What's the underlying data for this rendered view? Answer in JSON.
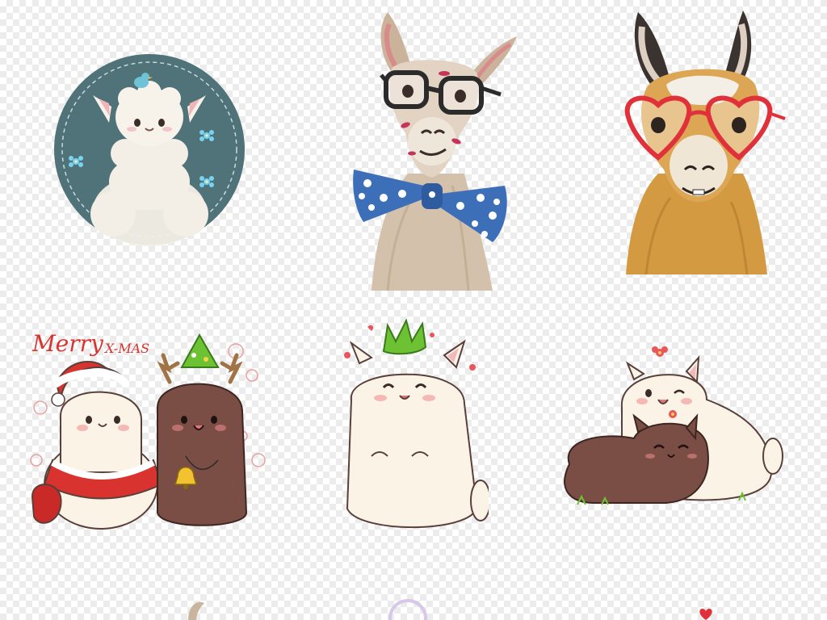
{
  "sheet": {
    "background": "transparent-checkerboard",
    "illustrations": [
      {
        "id": "round-badge-alpaca",
        "palette": {
          "disc": "#4f7378",
          "fur": "#f4efe6"
        }
      },
      {
        "id": "watercolor-llama-bowtie",
        "palette": {
          "fur": "#c9b49e",
          "bowtie": "#3d6fb8",
          "glasses": "#2b2b2b"
        }
      },
      {
        "id": "watercolor-llama-heart-glasses",
        "palette": {
          "fur": "#d39a42",
          "glasses": "#e0303a"
        }
      },
      {
        "id": "christmas-alpaca-pair",
        "text": {
          "merry": "Merry",
          "xmas": "X-MAS"
        },
        "palette": {
          "white": "#fbf4e6",
          "brown": "#7a4e45",
          "red": "#d8332f"
        }
      },
      {
        "id": "white-alpaca-leaf-hat",
        "palette": {
          "white": "#fbf4e6",
          "leaf": "#6cc233"
        }
      },
      {
        "id": "cuddling-alpaca-pair",
        "palette": {
          "white": "#fbf4e6",
          "brown": "#7a4e45",
          "flower": "#e9555b"
        }
      }
    ]
  }
}
